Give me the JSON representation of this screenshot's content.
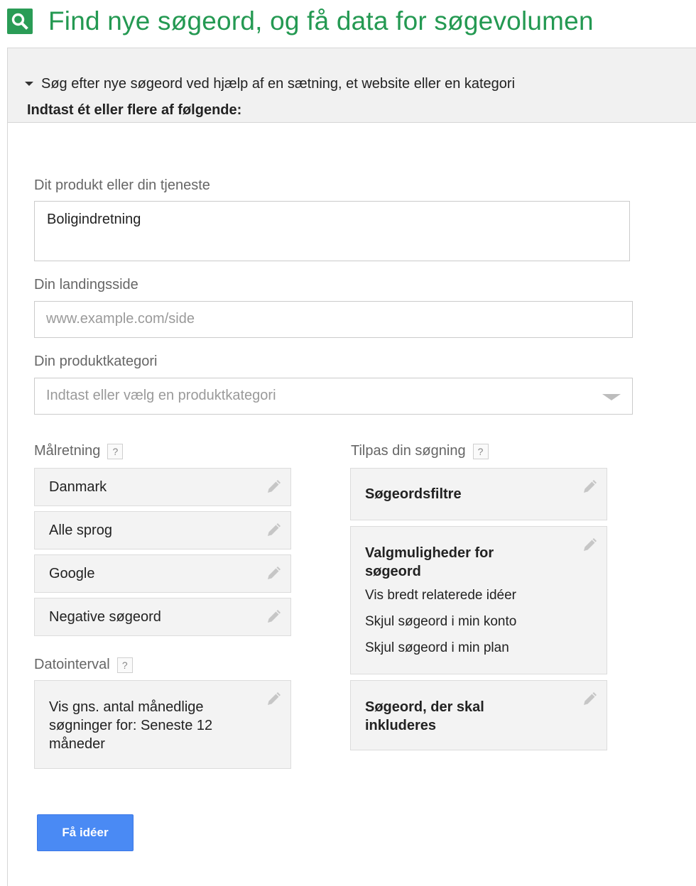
{
  "header": {
    "icon": "search-icon",
    "title": "Find nye søgeord, og få data for søgevolumen"
  },
  "section": {
    "expander_icon": "caret-down-icon",
    "title": "Søg efter nye søgeord ved hjælp af en sætning, et website eller en kategori"
  },
  "form": {
    "intro": "Indtast ét eller flere af følgende:",
    "product": {
      "label": "Dit produkt eller din tjeneste",
      "value": "Boligindretning"
    },
    "landing": {
      "label": "Din landingsside",
      "placeholder": "www.example.com/side"
    },
    "category": {
      "label": "Din produktkategori",
      "placeholder": "Indtast eller vælg en produktkategori"
    }
  },
  "targeting": {
    "label": "Målretning",
    "help": "?",
    "items": [
      "Danmark",
      "Alle sprog",
      "Google",
      "Negative søgeord"
    ]
  },
  "date_range": {
    "label": "Datointerval",
    "help": "?",
    "text": "Vis gns. antal månedlige søgninger for: Seneste 12 måneder"
  },
  "customize": {
    "label": "Tilpas din søgning",
    "help": "?",
    "filters_title": "Søgeordsfiltre",
    "options_title": "Valgmuligheder for søgeord",
    "options": [
      "Vis bredt relaterede idéer",
      "Skjul søgeord i min konto",
      "Skjul søgeord i min plan"
    ],
    "include_title": "Søgeord, der skal inkluderes"
  },
  "actions": {
    "get_ideas": "Få idéer"
  },
  "colors": {
    "brand_green": "#249952",
    "primary_blue": "#4a8af4"
  }
}
